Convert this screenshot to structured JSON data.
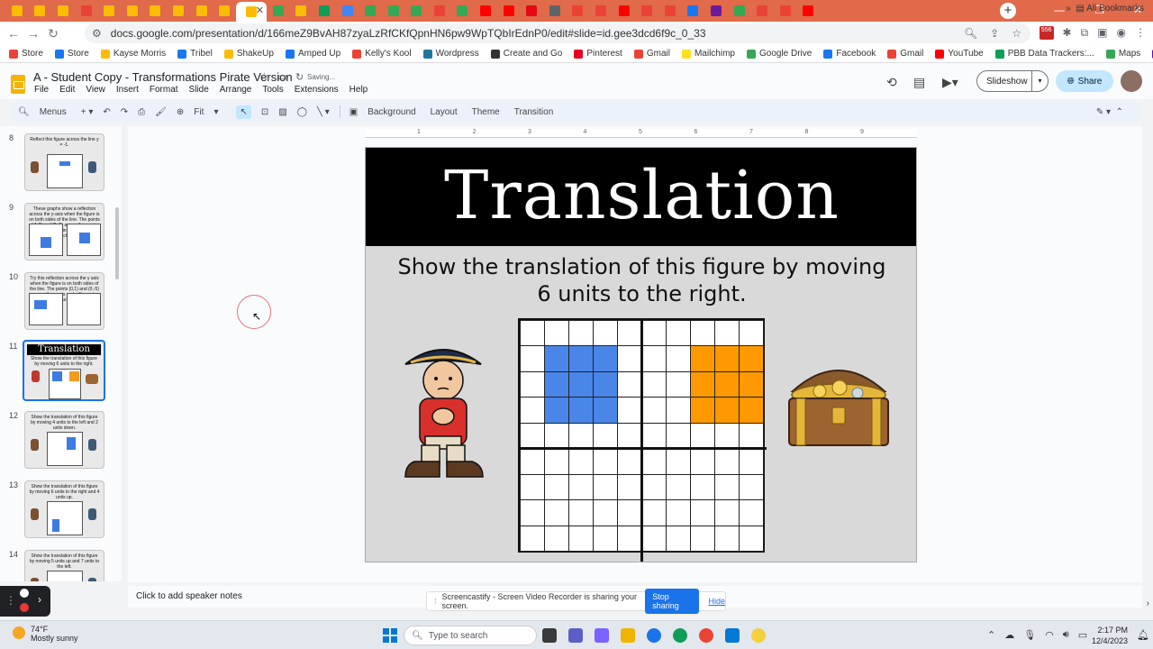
{
  "browser": {
    "url": "docs.google.com/presentation/d/166meZ9BvAH87zyaLzRfCKfQpnHN6pw9WpTQbIrEdnP0/edit#slide=id.gee3dcd6f9c_0_33",
    "bookmarks": [
      "Store",
      "Store",
      "Kayse Morris",
      "Tribel",
      "ShakeUp",
      "Amped Up",
      "Kelly's Kool",
      "Wordpress",
      "Create and Go",
      "Pinterest",
      "Gmail",
      "Mailchimp",
      "Google Drive",
      "Facebook",
      "Gmail",
      "YouTube",
      "PBB Data Trackers:...",
      "Maps",
      "Yahoo"
    ],
    "all_bookmarks": "All Bookmarks",
    "colors": {
      "tabstrip": "#e06a4a"
    }
  },
  "app": {
    "doc_title": "A - Student Copy - Transformations Pirate Version",
    "saving": "Saving...",
    "menu": [
      "File",
      "Edit",
      "View",
      "Insert",
      "Format",
      "Slide",
      "Arrange",
      "Tools",
      "Extensions",
      "Help"
    ],
    "slideshow_label": "Slideshow",
    "share_label": "Share"
  },
  "toolbar": {
    "menus_label": "Menus",
    "zoom": "Fit",
    "background": "Background",
    "layout": "Layout",
    "theme": "Theme",
    "transition": "Transition"
  },
  "filmstrip": {
    "slides": [
      {
        "num": "8",
        "text": "Reflect this figure across the line y = -1."
      },
      {
        "num": "9",
        "text": "These graphs show a reflection across the y-axis when the figure is on both sides of the line. The points (-1,0) and (3,-5) are on the x axis and will remain there in your reflection."
      },
      {
        "num": "10",
        "text": "Try this reflection across the y axis when the figure is on both sides of the line. The points (0,1) and (0,-5) are on the y axis and will remain there in your reflection."
      },
      {
        "num": "11",
        "text": "Translation",
        "sub": "Show the translation of this figure by moving 6 units to the right."
      },
      {
        "num": "12",
        "text": "Show the translation of this figure by moving 4 units to the left and 2 units down."
      },
      {
        "num": "13",
        "text": "Show the translation of this figure by moving 6 units to the right and 4 units up."
      },
      {
        "num": "14",
        "text": "Show the translation of this figure by moving 5 units up and 7 units to the left."
      }
    ]
  },
  "ruler": [
    "1",
    "2",
    "3",
    "4",
    "5",
    "6",
    "7",
    "8",
    "9"
  ],
  "slide": {
    "title": "Translation",
    "instruction": "Show the translation of this figure by moving 6 units to the right.",
    "grid": {
      "cols": 10,
      "rows": 9,
      "blue_cells": [
        [
          1,
          1
        ],
        [
          2,
          1
        ],
        [
          3,
          1
        ],
        [
          1,
          2
        ],
        [
          2,
          2
        ],
        [
          3,
          2
        ],
        [
          1,
          3
        ],
        [
          2,
          3
        ],
        [
          3,
          3
        ]
      ],
      "orange_cells": [
        [
          7,
          1
        ],
        [
          8,
          1
        ],
        [
          9,
          1
        ],
        [
          7,
          2
        ],
        [
          8,
          2
        ],
        [
          9,
          2
        ],
        [
          7,
          3
        ],
        [
          8,
          3
        ],
        [
          9,
          3
        ]
      ],
      "colors": {
        "blue": "#4a86e8",
        "orange": "#ff9900"
      }
    }
  },
  "notes_placeholder": "Click to add speaker notes",
  "screencastify": {
    "message": "Screencastify - Screen Video Recorder is sharing your screen.",
    "stop_label": "Stop sharing",
    "hide_label": "Hide"
  },
  "taskbar": {
    "temp": "74°F",
    "weather": "Mostly sunny",
    "search_placeholder": "Type to search",
    "time": "2:17 PM",
    "date": "12/4/2023"
  }
}
